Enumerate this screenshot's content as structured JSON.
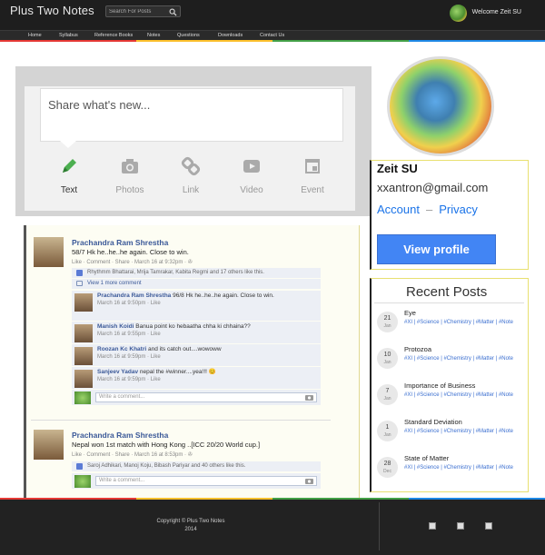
{
  "header": {
    "site_title": "Plus Two Notes",
    "search_placeholder": "Search For Posts",
    "welcome": "Welcome Zeit SU"
  },
  "nav": [
    "Home",
    "Syllabus",
    "Reference Books",
    "Notes",
    "Questions",
    "Downloads",
    "Contact Us"
  ],
  "share": {
    "prompt": "Share what's new...",
    "options": [
      {
        "label": "Text",
        "icon": "pencil-icon"
      },
      {
        "label": "Photos",
        "icon": "camera-icon"
      },
      {
        "label": "Link",
        "icon": "link-icon"
      },
      {
        "label": "Video",
        "icon": "video-icon"
      },
      {
        "label": "Event",
        "icon": "calendar-icon"
      }
    ]
  },
  "posts": [
    {
      "author": "Prachandra Ram Shrestha",
      "text": "58/7 Hk he..he..he again. Close to win.",
      "meta": "Like · Comment · Share · March 16 at 9:32pm · ✇",
      "likes": "Rhythmm Bhattarai, Mrija Tamrakar, Kabita Regmi and 17 others like this.",
      "view_more": "View 1 more comment",
      "comments": [
        {
          "author": "Prachandra Ram Shrestha",
          "text": "96/8 Hk he..he..he again. Close to win.",
          "meta": "March 16 at 9:50pm · Like"
        },
        {
          "author": "Manish Koidi",
          "text": "Banua point ko hebaatha chha ki chhaina??",
          "meta": "March 16 at 9:55pm · Like"
        },
        {
          "author": "Roozan Kc Khatri",
          "text": "and its catch out....wowoww",
          "meta": "March 16 at 9:59pm · Like"
        },
        {
          "author": "Sanjeev Yadav",
          "text": "nepal the #winner....yea!!! 😊",
          "meta": "March 16 at 9:59pm · Like"
        }
      ],
      "write_placeholder": "Write a comment..."
    },
    {
      "author": "Prachandra Ram Shrestha",
      "text": "Nepal won 1st match with Hong Kong ..[ICC 20/20 World cup.]",
      "meta": "Like · Comment · Share · March 16 at 8:53pm · ✇",
      "likes": "Saroj Adhikari, Manoj Koju, Bibash Pariyar and 40 others like this.",
      "write_placeholder": "Write a comment..."
    }
  ],
  "profile": {
    "name": "Zeit SU",
    "email": "xxantron@gmail.com",
    "account": "Account",
    "sep": "–",
    "privacy": "Privacy",
    "view_profile": "View profile"
  },
  "recent": {
    "title": "Recent Posts",
    "items": [
      {
        "day": "21",
        "month": "Jan",
        "title": "Eye",
        "tags": "#XI | #Science | #Chemistry | #Matter | #Note"
      },
      {
        "day": "10",
        "month": "Jan",
        "title": "Protozoa",
        "tags": "#XI | #Science | #Chemistry | #Matter | #Note"
      },
      {
        "day": "7",
        "month": "Jan",
        "title": "Importance of Business",
        "tags": "#XI | #Science | #Chemistry | #Matter | #Note"
      },
      {
        "day": "1",
        "month": "Jan",
        "title": "Standard Deviation",
        "tags": "#XI | #Science | #Chemistry | #Matter | #Note"
      },
      {
        "day": "28",
        "month": "Dec",
        "title": "State of Matter",
        "tags": "#XI | #Science | #Chemistry | #Matter | #Note"
      }
    ]
  },
  "footer": {
    "copyright": "Copyright © Plus Two Notes",
    "year": "2014"
  }
}
